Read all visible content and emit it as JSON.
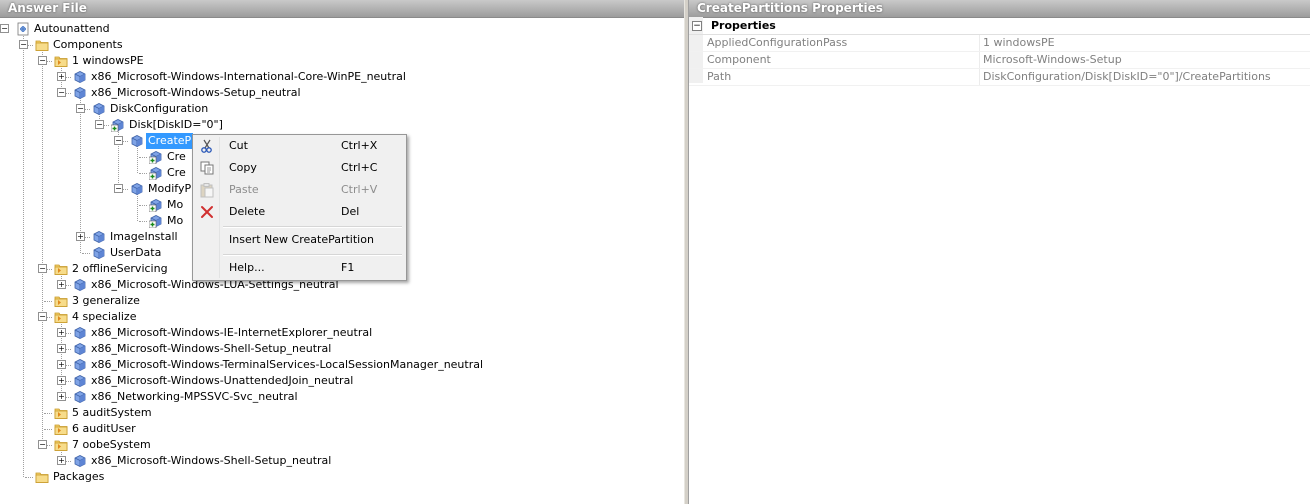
{
  "left_pane": {
    "title": "Answer File"
  },
  "right_pane": {
    "title": "CreatePartitions Properties"
  },
  "tree": {
    "nodes": [
      {
        "id": "autounattend",
        "label": "Autounattend",
        "level": 0,
        "icon": "answer-file-icon",
        "expander": "minus"
      },
      {
        "id": "components",
        "label": "Components",
        "level": 1,
        "icon": "folder-icon",
        "expander": "minus"
      },
      {
        "id": "windowspe",
        "label": "1 windowsPE",
        "level": 2,
        "icon": "pass-icon",
        "expander": "minus"
      },
      {
        "id": "intl-core",
        "label": "x86_Microsoft-Windows-International-Core-WinPE_neutral",
        "level": 3,
        "icon": "component-icon",
        "expander": "plus"
      },
      {
        "id": "setup",
        "label": "x86_Microsoft-Windows-Setup_neutral",
        "level": 3,
        "icon": "component-icon",
        "expander": "minus"
      },
      {
        "id": "diskconfig",
        "label": "DiskConfiguration",
        "level": 4,
        "icon": "component-icon",
        "expander": "minus"
      },
      {
        "id": "disk",
        "label": "Disk[DiskID=\"0\"]",
        "level": 5,
        "icon": "component-add-icon",
        "expander": "minus"
      },
      {
        "id": "createpartitions",
        "label": "CreateP",
        "level": 6,
        "icon": "component-icon",
        "expander": "minus",
        "selected": true
      },
      {
        "id": "cp1",
        "label": "Cre",
        "level": 7,
        "icon": "component-add-icon"
      },
      {
        "id": "cp2",
        "label": "Cre",
        "level": 7,
        "icon": "component-add-icon"
      },
      {
        "id": "modifypartitions",
        "label": "ModifyP",
        "level": 6,
        "icon": "component-icon",
        "expander": "minus"
      },
      {
        "id": "mp1",
        "label": "Mo",
        "level": 7,
        "icon": "component-add-icon"
      },
      {
        "id": "mp2",
        "label": "Mo",
        "level": 7,
        "icon": "component-add-icon"
      },
      {
        "id": "imageinstall",
        "label": "ImageInstall",
        "level": 4,
        "icon": "component-icon",
        "expander": "plus"
      },
      {
        "id": "userdata",
        "label": "UserData",
        "level": 4,
        "icon": "component-icon"
      },
      {
        "id": "offlineservicing",
        "label": "2 offlineServicing",
        "level": 2,
        "icon": "pass-icon",
        "expander": "minus"
      },
      {
        "id": "lua",
        "label": "x86_Microsoft-Windows-LUA-Settings_neutral",
        "level": 3,
        "icon": "component-icon",
        "expander": "plus"
      },
      {
        "id": "generalize",
        "label": "3 generalize",
        "level": 2,
        "icon": "pass-icon"
      },
      {
        "id": "specialize",
        "label": "4 specialize",
        "level": 2,
        "icon": "pass-icon",
        "expander": "minus"
      },
      {
        "id": "ie",
        "label": "x86_Microsoft-Windows-IE-InternetExplorer_neutral",
        "level": 3,
        "icon": "component-icon",
        "expander": "plus"
      },
      {
        "id": "shell1",
        "label": "x86_Microsoft-Windows-Shell-Setup_neutral",
        "level": 3,
        "icon": "component-icon",
        "expander": "plus"
      },
      {
        "id": "termsvc",
        "label": "x86_Microsoft-Windows-TerminalServices-LocalSessionManager_neutral",
        "level": 3,
        "icon": "component-icon",
        "expander": "plus"
      },
      {
        "id": "unattendjoin",
        "label": "x86_Microsoft-Windows-UnattendedJoin_neutral",
        "level": 3,
        "icon": "component-icon",
        "expander": "plus"
      },
      {
        "id": "mpssvc",
        "label": "x86_Networking-MPSSVC-Svc_neutral",
        "level": 3,
        "icon": "component-icon",
        "expander": "plus"
      },
      {
        "id": "auditsystem",
        "label": "5 auditSystem",
        "level": 2,
        "icon": "pass-icon"
      },
      {
        "id": "audituser",
        "label": "6 auditUser",
        "level": 2,
        "icon": "pass-icon"
      },
      {
        "id": "oobesystem",
        "label": "7 oobeSystem",
        "level": 2,
        "icon": "pass-icon",
        "expander": "minus"
      },
      {
        "id": "shell2",
        "label": "x86_Microsoft-Windows-Shell-Setup_neutral",
        "level": 3,
        "icon": "component-icon",
        "expander": "plus"
      },
      {
        "id": "packages",
        "label": "Packages",
        "level": 1,
        "icon": "folder-icon"
      }
    ]
  },
  "context_menu": {
    "items": [
      {
        "type": "item",
        "label": "Cut",
        "shortcut": "Ctrl+X",
        "icon": "scissors-icon",
        "enabled": true
      },
      {
        "type": "item",
        "label": "Copy",
        "shortcut": "Ctrl+C",
        "icon": "copy-icon",
        "enabled": true
      },
      {
        "type": "item",
        "label": "Paste",
        "shortcut": "Ctrl+V",
        "icon": "paste-icon",
        "enabled": false
      },
      {
        "type": "item",
        "label": "Delete",
        "shortcut": "Del",
        "icon": "delete-icon",
        "enabled": true
      },
      {
        "type": "separator"
      },
      {
        "type": "item",
        "label": "Insert New CreatePartition",
        "shortcut": "",
        "enabled": true
      },
      {
        "type": "separator"
      },
      {
        "type": "item",
        "label": "Help...",
        "shortcut": "F1",
        "enabled": true
      }
    ]
  },
  "properties": {
    "category": "Properties",
    "category_expander": "⊟",
    "rows": [
      {
        "name": "AppliedConfigurationPass",
        "value": "1 windowsPE"
      },
      {
        "name": "Component",
        "value": "Microsoft-Windows-Setup"
      },
      {
        "name": "Path",
        "value": "DiskConfiguration/Disk[DiskID=\"0\"]/CreatePartitions"
      }
    ]
  },
  "colors": {
    "selection": "#3399ff",
    "header": "#b0b0b0",
    "menu_bg": "#f0f0f0"
  }
}
